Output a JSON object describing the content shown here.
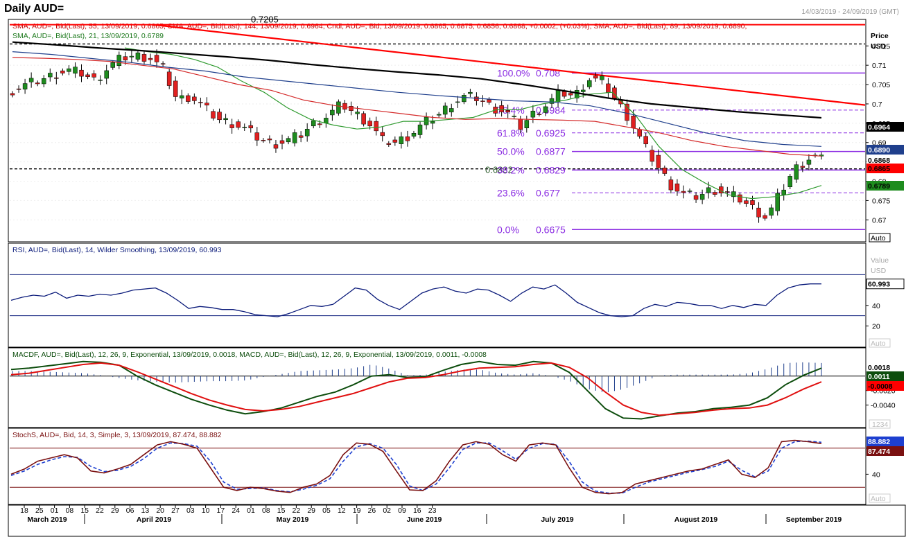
{
  "header": {
    "title": "Daily AUD=",
    "date_range": "14/03/2019 - 24/09/2019 (GMT)"
  },
  "legends": {
    "price_line1": "SMA, AUD=, Bid(Last), 55, 13/09/2019, 0.6865, SMA, AUD=, Bid(Last), 144, 13/09/2019, 0.6964, Cndl, AUD=, Bid, 13/09/2019, 0.6865, 0.6875, 0.6856, 0.6868, +0.0002, (+0.03%), SMA, AUD=, Bid(Last), 89, 13/09/2019, 0.6890,",
    "price_line2": "SMA, AUD=, Bid(Last), 21, 13/09/2019, 0.6789",
    "rsi": "RSI, AUD=, Bid(Last), 14, Wilder Smoothing, 13/09/2019, 60.993",
    "macd": "MACDF, AUD=, Bid(Last), 12, 26, 9, Exponential, 13/09/2019, 0.0018, MACD, AUD=, Bid(Last), 12, 26, 9, Exponential, 13/09/2019, 0.0011, -0.0008",
    "stoch": "StochS, AUD=, Bid, 14, 3, Simple, 3, 13/09/2019, 87.474, 88.882"
  },
  "axis_headers": {
    "price_title": "Price",
    "price_unit": "USD",
    "value_title": "Value",
    "value_unit": "USD",
    "auto": "Auto",
    "macd_scale_mark": "1234"
  },
  "colors": {
    "candle_up": "#1e8c1e",
    "candle_down": "#e02020",
    "sma21": "#2e9a2e",
    "sma55": "#d42a2a",
    "sma89": "#1f3f8c",
    "sma144": "#000000",
    "trendline": "#ff0000",
    "fib": "#8a2be2",
    "rsi": "#0a1a7a",
    "macd_line": "#0d4d0d",
    "signal_line": "#e01010",
    "stoch_k": "#7a1010",
    "stoch_d": "#1d3fd0"
  },
  "chart_data": [
    {
      "type": "candlestick",
      "panel": "price",
      "title": "Daily AUD=",
      "ylim": [
        0.6645,
        0.7215
      ],
      "y_ticks": [
        "0.715",
        "0.71",
        "0.705",
        "0.7",
        "0.695",
        "0.69",
        "0.685",
        "0.68",
        "0.675",
        "0.67"
      ],
      "x_day_ticks": [
        "18",
        "25",
        "01",
        "08",
        "15",
        "22",
        "29",
        "06",
        "13",
        "20",
        "27",
        "03",
        "10",
        "17",
        "24",
        "01",
        "08",
        "15",
        "22",
        "29",
        "05",
        "12",
        "19",
        "26",
        "02",
        "09",
        "16",
        "23"
      ],
      "x_month_labels": [
        "March 2019",
        "April 2019",
        "May 2019",
        "June 2019",
        "July 2019",
        "August 2019",
        "September 2019"
      ],
      "last_candle": {
        "date": "13/09/2019",
        "open": 0.6865,
        "high": 0.6875,
        "low": 0.6856,
        "close": 0.6868
      },
      "close_path": [
        0.7035,
        0.705,
        0.7062,
        0.7075,
        0.7088,
        0.708,
        0.706,
        0.7095,
        0.712,
        0.7125,
        0.712,
        0.709,
        0.701,
        0.702,
        0.699,
        0.696,
        0.695,
        0.6935,
        0.691,
        0.6895,
        0.6905,
        0.692,
        0.695,
        0.697,
        0.7,
        0.6975,
        0.695,
        0.6905,
        0.69,
        0.692,
        0.695,
        0.697,
        0.7,
        0.702,
        0.7015,
        0.699,
        0.698,
        0.694,
        0.6975,
        0.7,
        0.703,
        0.702,
        0.7065,
        0.706,
        0.701,
        0.696,
        0.6895,
        0.684,
        0.679,
        0.6765,
        0.676,
        0.678,
        0.677,
        0.6755,
        0.673,
        0.6705,
        0.677,
        0.683,
        0.6858,
        0.6868
      ],
      "fib_levels": [
        {
          "label": "100.0%",
          "value": 0.708
        },
        {
          "label": "76.4%",
          "value": 0.6984
        },
        {
          "label": "61.8%",
          "value": 0.6925
        },
        {
          "label": "50.0%",
          "value": 0.6877
        },
        {
          "label": "38.2%",
          "value": 0.6829
        },
        {
          "label": "23.6%",
          "value": 0.677
        },
        {
          "label": "0.0%",
          "value": 0.6675
        }
      ],
      "horizontal_levels": [
        {
          "label": "0.7205",
          "value": 0.7205,
          "style": "solid-red"
        },
        {
          "label": "",
          "value": 0.7155,
          "style": "dashed-black"
        },
        {
          "label": "0.6832",
          "value": 0.6832,
          "style": "dashed-black"
        }
      ],
      "trendline": {
        "start": 0.7205,
        "end": 0.6997
      },
      "series": [
        {
          "name": "SMA 21",
          "last": 0.6789,
          "values": [
            0.7145,
            0.7135,
            0.7128,
            0.7115,
            0.7095,
            0.706,
            0.703,
            0.699,
            0.696,
            0.6945,
            0.6935,
            0.694,
            0.6955,
            0.6955,
            0.696,
            0.6965,
            0.6985,
            0.6985,
            0.7,
            0.701,
            0.7025,
            0.703,
            0.697,
            0.689,
            0.683,
            0.6795,
            0.6765,
            0.6755,
            0.676,
            0.677,
            0.6789
          ]
        },
        {
          "name": "SMA 55",
          "last": 0.6865,
          "values": [
            0.712,
            0.7118,
            0.7115,
            0.711,
            0.71,
            0.709,
            0.707,
            0.705,
            0.7035,
            0.701,
            0.6995,
            0.6985,
            0.6975,
            0.6965,
            0.696,
            0.6962,
            0.696,
            0.6958,
            0.6955,
            0.694,
            0.6925,
            0.6905,
            0.689,
            0.688,
            0.687,
            0.6865
          ]
        },
        {
          "name": "SMA 89",
          "last": 0.689,
          "values": [
            0.7135,
            0.7128,
            0.7118,
            0.7108,
            0.7095,
            0.7085,
            0.707,
            0.706,
            0.705,
            0.704,
            0.703,
            0.7022,
            0.7015,
            0.7008,
            0.7005,
            0.6995,
            0.6975,
            0.695,
            0.6925,
            0.6905,
            0.6895,
            0.689
          ]
        },
        {
          "name": "SMA 144",
          "last": 0.6964,
          "values": [
            0.716,
            0.7153,
            0.7145,
            0.7138,
            0.713,
            0.7122,
            0.7113,
            0.7102,
            0.7092,
            0.7083,
            0.7075,
            0.7065,
            0.705,
            0.7033,
            0.7015,
            0.7,
            0.699,
            0.698,
            0.6972,
            0.6964
          ]
        }
      ],
      "axis_value_tags": [
        {
          "text": "0.6964",
          "series": "SMA 144"
        },
        {
          "text": "0.6890",
          "series": "SMA 89"
        },
        {
          "text": "0.6868",
          "series": "Close"
        },
        {
          "text": "0.6865",
          "series": "SMA 55"
        },
        {
          "text": "0.6789",
          "series": "SMA 21"
        }
      ]
    },
    {
      "type": "line",
      "panel": "rsi",
      "ylim": [
        0,
        100
      ],
      "y_ticks": [
        "60",
        "40",
        "20"
      ],
      "levels": [
        70,
        30
      ],
      "series": [
        {
          "name": "RSI 14",
          "last": 60.993,
          "values": [
            45,
            48,
            50,
            49,
            53,
            47,
            50,
            49,
            51,
            50,
            52,
            55,
            56,
            57,
            52,
            45,
            37,
            39,
            38,
            36,
            36,
            34,
            31,
            30,
            29,
            32,
            36,
            40,
            39,
            41,
            49,
            57,
            55,
            46,
            40,
            36,
            44,
            52,
            56,
            58,
            54,
            52,
            56,
            55,
            50,
            44,
            52,
            58,
            56,
            60,
            52,
            43,
            38,
            33,
            30,
            29,
            30,
            37,
            41,
            39,
            43,
            42,
            40,
            40,
            37,
            40,
            38,
            41,
            40,
            50,
            57,
            60,
            61,
            61
          ]
        }
      ],
      "axis_value_tags": [
        {
          "text": "60.993"
        }
      ]
    },
    {
      "type": "bar+line",
      "panel": "macd",
      "ylim": [
        -0.007,
        0.0038
      ],
      "y_ticks": [
        "-0.0020",
        "-0.0040"
      ],
      "series": [
        {
          "name": "MACD",
          "last": 0.0011,
          "values": [
            0.0009,
            0.0011,
            0.0014,
            0.0017,
            0.002,
            0.0019,
            0.0015,
            0.0,
            -0.0012,
            -0.0022,
            -0.0032,
            -0.004,
            -0.0047,
            -0.0052,
            -0.0049,
            -0.0044,
            -0.0036,
            -0.0028,
            -0.0022,
            -0.0012,
            0.0,
            0.0002,
            -0.0002,
            -0.0001,
            0.0008,
            0.0016,
            0.002,
            0.0016,
            0.0015,
            0.002,
            0.0018,
            0.0005,
            -0.002,
            -0.0045,
            -0.0058,
            -0.0059,
            -0.0055,
            -0.0051,
            -0.0049,
            -0.0045,
            -0.0043,
            -0.004,
            -0.003,
            -0.0012,
            0.0001,
            0.0011
          ]
        },
        {
          "name": "Signal",
          "last": -0.0008,
          "values": [
            0.0002,
            0.0004,
            0.0008,
            0.0012,
            0.0016,
            0.0018,
            0.0015,
            0.0006,
            -0.0004,
            -0.0014,
            -0.0024,
            -0.0033,
            -0.004,
            -0.0046,
            -0.0048,
            -0.0046,
            -0.0042,
            -0.0036,
            -0.003,
            -0.0024,
            -0.0016,
            -0.0008,
            -0.0003,
            -0.0002,
            0.0002,
            0.0007,
            0.0011,
            0.0012,
            0.0013,
            0.0016,
            0.0018,
            0.0012,
            -0.0002,
            -0.0022,
            -0.004,
            -0.005,
            -0.0054,
            -0.0052,
            -0.005,
            -0.0047,
            -0.0045,
            -0.0044,
            -0.004,
            -0.003,
            -0.0018,
            -0.0008
          ]
        },
        {
          "name": "Histogram",
          "last": 0.0018,
          "values": [
            0.0007,
            0.0007,
            0.0006,
            0.0005,
            0.0004,
            0.0001,
            -0.0003,
            -0.0006,
            -0.0008,
            -0.0009,
            -0.0008,
            -0.0007,
            -0.0007,
            -0.0006,
            -0.0001,
            0.0003,
            0.0007,
            0.0008,
            0.0009,
            0.0011,
            0.0016,
            0.001,
            0.0001,
            0.0002,
            0.0006,
            0.0009,
            0.0009,
            0.0004,
            0.0002,
            0.0004,
            0.0,
            -0.0007,
            -0.0018,
            -0.0023,
            -0.0018,
            -0.0009,
            0.0001,
            0.0002,
            0.0002,
            0.0002,
            0.0002,
            0.0004,
            0.001,
            0.0018,
            0.0019,
            0.0018
          ]
        }
      ],
      "axis_value_tags": [
        {
          "text": "0.0018",
          "series": "Histogram"
        },
        {
          "text": "0.0011",
          "series": "MACD"
        },
        {
          "text": "-0.0008",
          "series": "Signal"
        }
      ]
    },
    {
      "type": "line",
      "panel": "stochastic",
      "ylim": [
        0,
        100
      ],
      "y_ticks": [
        "80",
        "40"
      ],
      "levels": [
        80,
        20
      ],
      "series": [
        {
          "name": "%K",
          "last": 87.474,
          "values": [
            40,
            48,
            60,
            65,
            70,
            65,
            45,
            42,
            48,
            55,
            70,
            85,
            90,
            86,
            80,
            50,
            20,
            15,
            20,
            18,
            14,
            12,
            20,
            25,
            38,
            70,
            88,
            86,
            75,
            45,
            16,
            15,
            30,
            60,
            85,
            90,
            86,
            70,
            60,
            85,
            88,
            85,
            50,
            20,
            12,
            10,
            12,
            25,
            30,
            35,
            40,
            45,
            48,
            55,
            62,
            40,
            35,
            50,
            90,
            92,
            90,
            87
          ]
        },
        {
          "name": "%D",
          "last": 88.882,
          "values": [
            38,
            45,
            55,
            62,
            67,
            66,
            52,
            44,
            46,
            52,
            64,
            80,
            88,
            87,
            83,
            60,
            28,
            17,
            18,
            19,
            15,
            13,
            17,
            23,
            33,
            60,
            82,
            87,
            80,
            55,
            22,
            15,
            25,
            50,
            78,
            88,
            88,
            76,
            63,
            80,
            87,
            86,
            60,
            28,
            14,
            11,
            11,
            20,
            28,
            33,
            38,
            43,
            47,
            52,
            60,
            46,
            36,
            45,
            80,
            90,
            91,
            89
          ]
        }
      ],
      "axis_value_tags": [
        {
          "text": "88.882",
          "series": "%D"
        },
        {
          "text": "87.474",
          "series": "%K"
        }
      ]
    }
  ]
}
